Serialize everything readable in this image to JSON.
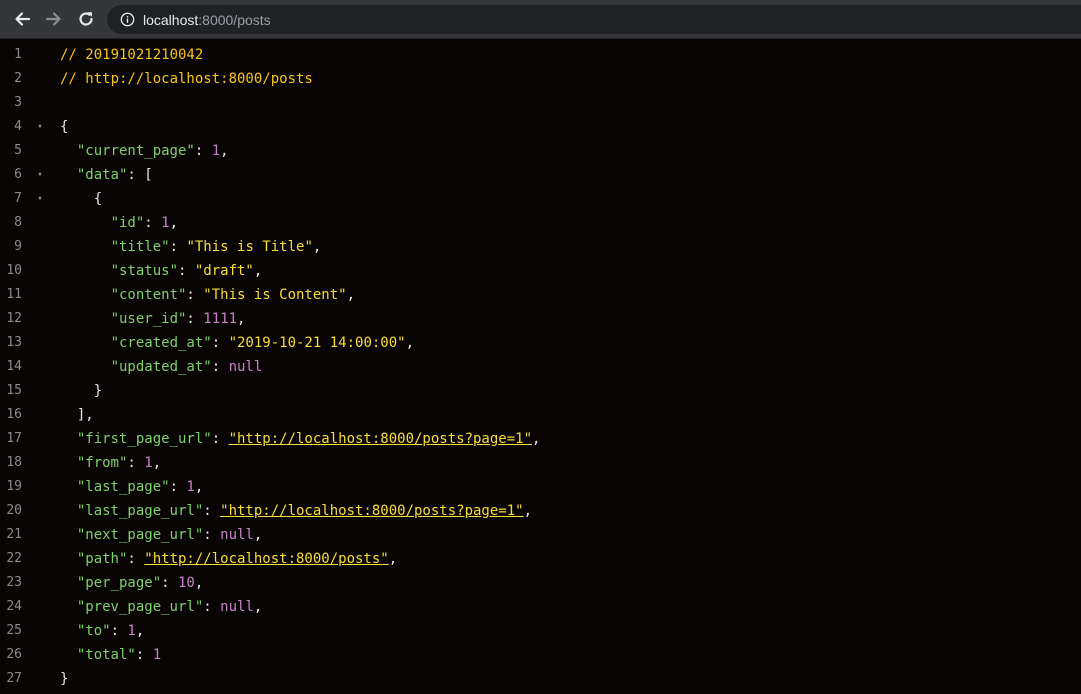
{
  "browser": {
    "url_host": "localhost",
    "url_rest": ":8000/posts",
    "colors": {
      "toolbar": "#35363a",
      "omnibox": "#202124"
    }
  },
  "editor": {
    "colors": {
      "background": "#0a0505",
      "key": "#7fd16b",
      "string": "#f7df35",
      "number": "#c583c6",
      "comment": "#f5c518"
    },
    "lines": [
      {
        "n": "1",
        "fold": false,
        "indent": 0,
        "tokens": [
          {
            "t": "cmt",
            "v": "// 20191021210042"
          }
        ]
      },
      {
        "n": "2",
        "fold": false,
        "indent": 0,
        "tokens": [
          {
            "t": "cmt",
            "v": "// http://localhost:8000/posts"
          }
        ]
      },
      {
        "n": "3",
        "fold": false,
        "indent": 0,
        "tokens": []
      },
      {
        "n": "4",
        "fold": true,
        "indent": 0,
        "tokens": [
          {
            "t": "punc",
            "v": "{"
          }
        ]
      },
      {
        "n": "5",
        "fold": false,
        "indent": 1,
        "tokens": [
          {
            "t": "key",
            "v": "\"current_page\""
          },
          {
            "t": "punc",
            "v": ": "
          },
          {
            "t": "num",
            "v": "1"
          },
          {
            "t": "punc",
            "v": ","
          }
        ]
      },
      {
        "n": "6",
        "fold": true,
        "indent": 1,
        "tokens": [
          {
            "t": "key",
            "v": "\"data\""
          },
          {
            "t": "punc",
            "v": ": ["
          }
        ]
      },
      {
        "n": "7",
        "fold": true,
        "indent": 2,
        "tokens": [
          {
            "t": "punc",
            "v": "{"
          }
        ]
      },
      {
        "n": "8",
        "fold": false,
        "indent": 3,
        "tokens": [
          {
            "t": "key",
            "v": "\"id\""
          },
          {
            "t": "punc",
            "v": ": "
          },
          {
            "t": "num",
            "v": "1"
          },
          {
            "t": "punc",
            "v": ","
          }
        ]
      },
      {
        "n": "9",
        "fold": false,
        "indent": 3,
        "tokens": [
          {
            "t": "key",
            "v": "\"title\""
          },
          {
            "t": "punc",
            "v": ": "
          },
          {
            "t": "str",
            "v": "\"This is Title\""
          },
          {
            "t": "punc",
            "v": ","
          }
        ]
      },
      {
        "n": "10",
        "fold": false,
        "indent": 3,
        "tokens": [
          {
            "t": "key",
            "v": "\"status\""
          },
          {
            "t": "punc",
            "v": ": "
          },
          {
            "t": "str",
            "v": "\"draft\""
          },
          {
            "t": "punc",
            "v": ","
          }
        ]
      },
      {
        "n": "11",
        "fold": false,
        "indent": 3,
        "tokens": [
          {
            "t": "key",
            "v": "\"content\""
          },
          {
            "t": "punc",
            "v": ": "
          },
          {
            "t": "str",
            "v": "\"This is Content\""
          },
          {
            "t": "punc",
            "v": ","
          }
        ]
      },
      {
        "n": "12",
        "fold": false,
        "indent": 3,
        "tokens": [
          {
            "t": "key",
            "v": "\"user_id\""
          },
          {
            "t": "punc",
            "v": ": "
          },
          {
            "t": "num",
            "v": "1111"
          },
          {
            "t": "punc",
            "v": ","
          }
        ]
      },
      {
        "n": "13",
        "fold": false,
        "indent": 3,
        "tokens": [
          {
            "t": "key",
            "v": "\"created_at\""
          },
          {
            "t": "punc",
            "v": ": "
          },
          {
            "t": "str",
            "v": "\"2019-10-21 14:00:00\""
          },
          {
            "t": "punc",
            "v": ","
          }
        ]
      },
      {
        "n": "14",
        "fold": false,
        "indent": 3,
        "tokens": [
          {
            "t": "key",
            "v": "\"updated_at\""
          },
          {
            "t": "punc",
            "v": ": "
          },
          {
            "t": "nul",
            "v": "null"
          }
        ]
      },
      {
        "n": "15",
        "fold": false,
        "indent": 2,
        "tokens": [
          {
            "t": "punc",
            "v": "}"
          }
        ]
      },
      {
        "n": "16",
        "fold": false,
        "indent": 1,
        "tokens": [
          {
            "t": "punc",
            "v": "],"
          }
        ]
      },
      {
        "n": "17",
        "fold": false,
        "indent": 1,
        "tokens": [
          {
            "t": "key",
            "v": "\"first_page_url\""
          },
          {
            "t": "punc",
            "v": ": "
          },
          {
            "t": "lnk",
            "v": "\"http://localhost:8000/posts?page=1\""
          },
          {
            "t": "punc",
            "v": ","
          }
        ]
      },
      {
        "n": "18",
        "fold": false,
        "indent": 1,
        "tokens": [
          {
            "t": "key",
            "v": "\"from\""
          },
          {
            "t": "punc",
            "v": ": "
          },
          {
            "t": "num",
            "v": "1"
          },
          {
            "t": "punc",
            "v": ","
          }
        ]
      },
      {
        "n": "19",
        "fold": false,
        "indent": 1,
        "tokens": [
          {
            "t": "key",
            "v": "\"last_page\""
          },
          {
            "t": "punc",
            "v": ": "
          },
          {
            "t": "num",
            "v": "1"
          },
          {
            "t": "punc",
            "v": ","
          }
        ]
      },
      {
        "n": "20",
        "fold": false,
        "indent": 1,
        "tokens": [
          {
            "t": "key",
            "v": "\"last_page_url\""
          },
          {
            "t": "punc",
            "v": ": "
          },
          {
            "t": "lnk",
            "v": "\"http://localhost:8000/posts?page=1\""
          },
          {
            "t": "punc",
            "v": ","
          }
        ]
      },
      {
        "n": "21",
        "fold": false,
        "indent": 1,
        "tokens": [
          {
            "t": "key",
            "v": "\"next_page_url\""
          },
          {
            "t": "punc",
            "v": ": "
          },
          {
            "t": "nul",
            "v": "null"
          },
          {
            "t": "punc",
            "v": ","
          }
        ]
      },
      {
        "n": "22",
        "fold": false,
        "indent": 1,
        "tokens": [
          {
            "t": "key",
            "v": "\"path\""
          },
          {
            "t": "punc",
            "v": ": "
          },
          {
            "t": "lnk",
            "v": "\"http://localhost:8000/posts\""
          },
          {
            "t": "punc",
            "v": ","
          }
        ]
      },
      {
        "n": "23",
        "fold": false,
        "indent": 1,
        "tokens": [
          {
            "t": "key",
            "v": "\"per_page\""
          },
          {
            "t": "punc",
            "v": ": "
          },
          {
            "t": "num",
            "v": "10"
          },
          {
            "t": "punc",
            "v": ","
          }
        ]
      },
      {
        "n": "24",
        "fold": false,
        "indent": 1,
        "tokens": [
          {
            "t": "key",
            "v": "\"prev_page_url\""
          },
          {
            "t": "punc",
            "v": ": "
          },
          {
            "t": "nul",
            "v": "null"
          },
          {
            "t": "punc",
            "v": ","
          }
        ]
      },
      {
        "n": "25",
        "fold": false,
        "indent": 1,
        "tokens": [
          {
            "t": "key",
            "v": "\"to\""
          },
          {
            "t": "punc",
            "v": ": "
          },
          {
            "t": "num",
            "v": "1"
          },
          {
            "t": "punc",
            "v": ","
          }
        ]
      },
      {
        "n": "26",
        "fold": false,
        "indent": 1,
        "tokens": [
          {
            "t": "key",
            "v": "\"total\""
          },
          {
            "t": "punc",
            "v": ": "
          },
          {
            "t": "num",
            "v": "1"
          }
        ]
      },
      {
        "n": "27",
        "fold": false,
        "indent": 0,
        "tokens": [
          {
            "t": "punc",
            "v": "}"
          }
        ]
      }
    ]
  }
}
